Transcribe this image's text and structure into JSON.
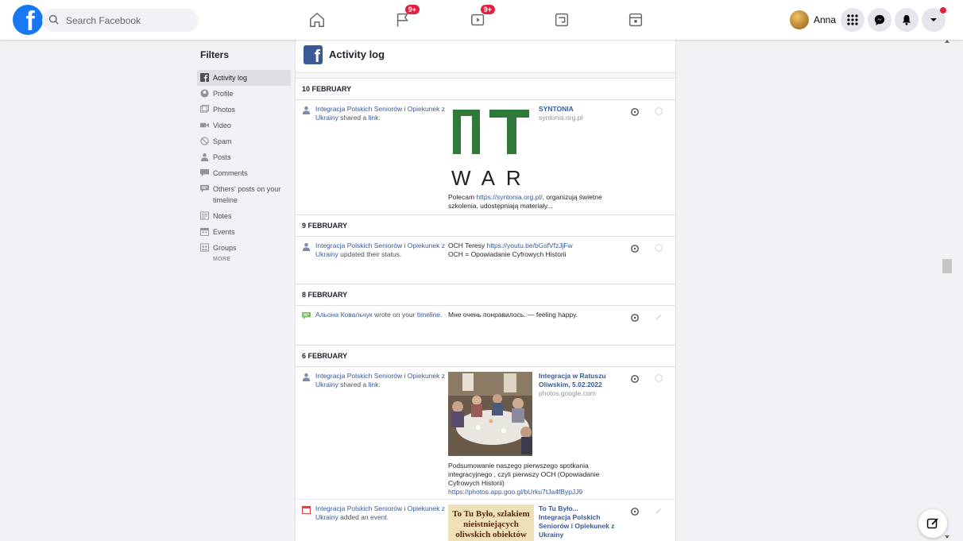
{
  "topbar": {
    "logo": "f",
    "search_placeholder": "Search Facebook",
    "nav": [
      {
        "name": "home",
        "badge": ""
      },
      {
        "name": "pages",
        "badge": "9+"
      },
      {
        "name": "watch",
        "badge": "9+"
      },
      {
        "name": "gaming",
        "badge": ""
      },
      {
        "name": "news",
        "badge": ""
      }
    ],
    "profile_name": "Anna"
  },
  "filters": {
    "title": "Filters",
    "items": [
      {
        "label": "Activity log",
        "icon": "facebook-icon",
        "active": true
      },
      {
        "label": "Profile",
        "icon": "profile-icon"
      },
      {
        "label": "Photos",
        "icon": "photos-icon"
      },
      {
        "label": "Video",
        "icon": "video-icon"
      },
      {
        "label": "Spam",
        "icon": "spam-icon"
      },
      {
        "label": "Posts",
        "icon": "posts-icon"
      },
      {
        "label": "Comments",
        "icon": "comments-icon"
      },
      {
        "label": "Others' posts on your timeline",
        "icon": "others-posts-icon"
      },
      {
        "label": "Notes",
        "icon": "notes-icon"
      },
      {
        "label": "Events",
        "icon": "events-icon"
      },
      {
        "label": "Groups",
        "icon": "groups-icon"
      }
    ],
    "more": "MORE"
  },
  "activity": {
    "title": "Activity log",
    "groups": [
      {
        "date": "10 FEBRUARY",
        "entries": [
          {
            "actor": "Integracja Polskich Seniorów i Opiekunek z Ukrainy",
            "verb": " shared a ",
            "object": "link",
            "tail": ".",
            "preview_title": "SYNTONIA",
            "preview_source": "syntonia.org.pl",
            "text_before": "Polecam ",
            "text_link": "https://syntonia.org.pl/",
            "text_after": ", organizują świetne szkolenia, udostępniają materiały..."
          }
        ]
      },
      {
        "date": "9 FEBRUARY",
        "entries": [
          {
            "actor": "Integracja Polskich Seniorów i Opiekunek z Ukrainy",
            "verb": " updated their status.",
            "text_before": "OCH Teresy ",
            "text_link": "https://youtu.be/bGsfVfzJjFw",
            "text_line2": "OCH = Opowiadanie Cyfrowych Historii"
          }
        ]
      },
      {
        "date": "8 FEBRUARY",
        "entries": [
          {
            "actor": "Альона Ковальчук",
            "verb": " wrote on your ",
            "object": "timeline",
            "tail": ".",
            "text": "Мне очень понравилось. — feeling happy."
          }
        ]
      },
      {
        "date": "6 FEBRUARY",
        "entries": [
          {
            "actor": "Integracja Polskich Seniorów i Opiekunek z Ukrainy",
            "verb": " shared a ",
            "object": "link",
            "tail": ".",
            "preview_title": "Integracja w Ratuszu Oliwskim, 5.02.2022",
            "preview_source": "photos.google.com",
            "text_before": "Podsumowanie naszego pierwszego spotkania integracyjnego , czyli pierwszy OCH (Opowiadanie Cyfrowych Historii) ",
            "text_link": "https://photos.app.goo.gl/bUrku7tJa4fBypJJ9"
          },
          {
            "actor": "Integracja Polskich Seniorów i Opiekunek z Ukrainy",
            "verb": " added an ",
            "object": "event",
            "tail": ".",
            "preview_title": "To Tu Było...",
            "preview_subtitle": "Integracja Polskich Seniorów i Opiekunek z Ukrainy",
            "image_text": "To Tu Było, szlakiem nieistniejących oliwskich obiektów"
          }
        ]
      }
    ]
  },
  "logo_letters": {
    "top": "n7",
    "bottom": "WAR"
  }
}
